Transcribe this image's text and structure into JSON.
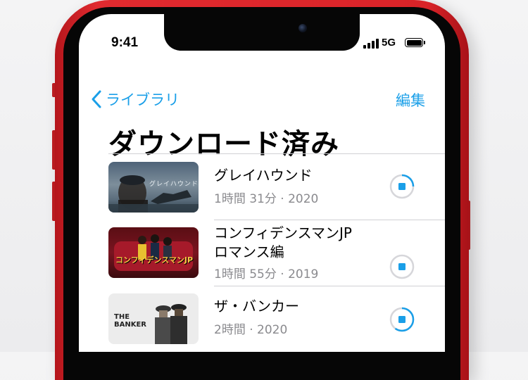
{
  "status_bar": {
    "time": "9:41",
    "network": "5G",
    "battery_level": 1.0
  },
  "nav": {
    "back_label": "ライブラリ",
    "edit_label": "編集"
  },
  "page_title": "ダウンロード済み",
  "items": [
    {
      "title_lines": [
        "グレイハウンド"
      ],
      "meta": "1時間 31分 · 2020",
      "thumb_text": "グレイハウンド",
      "download_progress": 0.25,
      "accent": "#1a9fe8"
    },
    {
      "title_lines": [
        "コンフィデンスマンJP",
        "ロマンス編"
      ],
      "meta": "1時間 55分 · 2019",
      "thumb_text": "コンフィデンスマンJP",
      "download_progress": 0.0,
      "accent": "#1a9fe8"
    },
    {
      "title_lines": [
        "ザ・バンカー"
      ],
      "meta": "2時間 · 2020",
      "thumb_text": "THE BANKER",
      "download_progress": 0.6,
      "accent": "#1a9fe8"
    }
  ],
  "colors": {
    "frame": "#d92328",
    "accent": "#1a9fe8"
  }
}
